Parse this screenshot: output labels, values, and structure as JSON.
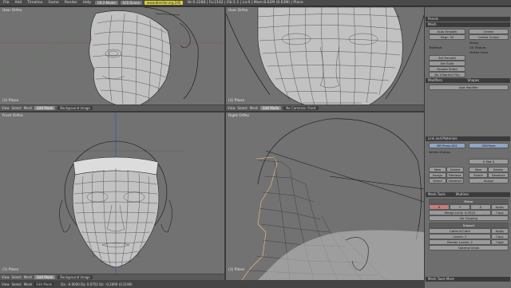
{
  "topbar": {
    "menus": [
      "File",
      "Add",
      "Timeline",
      "Game",
      "Render",
      "Help"
    ],
    "screen": "SR:2-Model",
    "scene": "SCE:Scene",
    "www": "www.blender.org 245",
    "stats": "Ve:0-2288 | Fa:2162 | Ob:1-1 | La:0 | Mem:8.62M (0.63M) | Plane"
  },
  "viewports": [
    {
      "label": "User Ortho",
      "object": "(1) Plane",
      "menus": [
        "View",
        "Select",
        "Mesh"
      ],
      "mode": "Edit Mode",
      "shading": "Background image"
    },
    {
      "label": "User Ortho",
      "object": "(1) Plane",
      "menus": [
        "View",
        "Select",
        "Mesh"
      ],
      "mode": "Edit Mode",
      "shading": "No Cameras: Front"
    },
    {
      "label": "Front Ortho",
      "object": "(1) Plane",
      "menus": [
        "View",
        "Select",
        "Mesh"
      ],
      "mode": "Edit Mode",
      "shading": "Background image"
    },
    {
      "label": "Right Ortho",
      "object": "(1) Plane",
      "menus": [
        "View",
        "Select",
        "Mesh"
      ],
      "mode": "Edit Mode",
      "shading": "No Cameras: Front"
    }
  ],
  "panel": {
    "header_menus": [
      "Panels"
    ],
    "mesh_section": "Mesh",
    "auto_smooth": "Auto Smooth",
    "degr": "Degr: 30",
    "center": "Center",
    "cursor": "Centre Cursor",
    "sticky": "Sticky",
    "uv_texture": "UV Texture",
    "vertex_color": "Vertex Color",
    "texmesh": "TexMesh:",
    "set_smooth": "Set Smooth",
    "set_solid": "Set Solid",
    "double_sided": "Double Sided",
    "no_vnormal_flip": "No V.Normal Flip",
    "modifiers_tab": "Modifiers",
    "shapes_tab": "Shapes",
    "add_modifier": "Add Modifier",
    "link_materials": "Link and Materials",
    "me_plane": "ME:Plane.001",
    "ob_plane": "OB:Plane",
    "vertex_groups": "Vertex Groups",
    "new": "New",
    "delete": "Delete",
    "assign": "Assign",
    "remove": "Remove",
    "select": "Select",
    "deselect": "Deselect",
    "mat_count": "0 Mat 0",
    "mesh_tools": "Mesh Tools",
    "multires": "Multires",
    "mirror_section": "Mirror",
    "subsurf_section": "Subsurf",
    "catmull": "Catmull-Clark",
    "levels": "Levels: 2",
    "render_levels": "Render Levels: 2",
    "optimal_draw": "Optimal Draw",
    "mesh_tools_more": "Mesh Tools More",
    "axis_x": "X",
    "axis_y": "Y",
    "axis_z": "Z",
    "merge_limit": "Merge Limit: 0.0010",
    "do_clipping": "Do Clipping",
    "apply": "Apply",
    "copy": "Copy",
    "editmode_cage": "Cage"
  },
  "statusbar": {
    "menus": [
      "View",
      "Select",
      "Mesh"
    ],
    "mode": "Edit Mode",
    "coords": "Dx: -0.0000 Dy: 0.0752 Dz: -0.2069 (0.2196)"
  },
  "colors": {
    "viewport_bg": "#727272",
    "mesh_fill": "#c2c2c2",
    "wire": "#1a1a1a",
    "selected": "#ffc080",
    "panel_bg": "#6e6e6e"
  }
}
